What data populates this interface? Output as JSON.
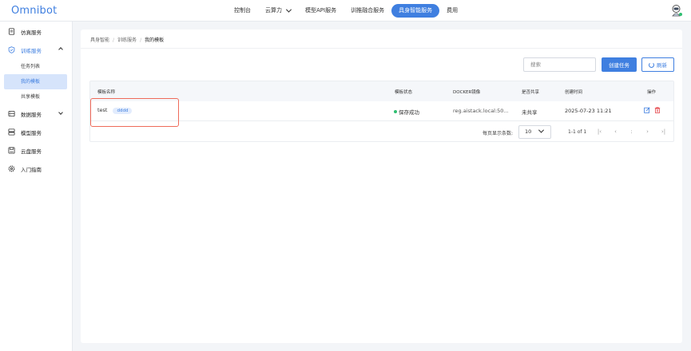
{
  "app": {
    "logo": "Omnibot"
  },
  "nav": {
    "items": [
      {
        "label": "控制台"
      },
      {
        "label": "云算力"
      },
      {
        "label": "模型API服务"
      },
      {
        "label": "训推融合服务"
      },
      {
        "label": "具身智能服务"
      },
      {
        "label": "费用"
      }
    ],
    "active_color": "#3f7fe0"
  },
  "sidebar": {
    "items": [
      {
        "label": "仿真服务",
        "icon": "document-icon"
      },
      {
        "label": "训练服务",
        "icon": "shield-icon"
      },
      {
        "label": "数据服务",
        "icon": "database-icon"
      },
      {
        "label": "模型服务",
        "icon": "server-icon"
      },
      {
        "label": "云盘服务",
        "icon": "disk-icon"
      },
      {
        "label": "入门指南",
        "icon": "gear-icon"
      }
    ],
    "training_sub": [
      {
        "label": "任务列表"
      },
      {
        "label": "我的模板"
      },
      {
        "label": "共享模板"
      }
    ]
  },
  "breadcrumb": [
    "具身智能",
    "训练服务",
    "我的模板"
  ],
  "toolbar": {
    "search_placeholder": "搜索",
    "create_label": "创建任务",
    "refresh_label": "刷新"
  },
  "table": {
    "headers": [
      "模板名称",
      "模板状态",
      "DOCKER镜像",
      "是否共享",
      "创建时间",
      "操作"
    ],
    "rows": [
      {
        "name": "test",
        "tag": "dddd",
        "status": "保存成功",
        "image": "reg.aistack.local:50...",
        "shared": "未共享",
        "created": "2025-07-23 11:21"
      }
    ]
  },
  "pagination": {
    "per_page_label": "每页显示条数:",
    "per_page_value": "10",
    "range": "1-1 of 1"
  },
  "colors": {
    "accent": "#3f7fe0",
    "success": "#2fbf71",
    "danger": "#e5484d",
    "highlight": "#ef6b5a"
  }
}
